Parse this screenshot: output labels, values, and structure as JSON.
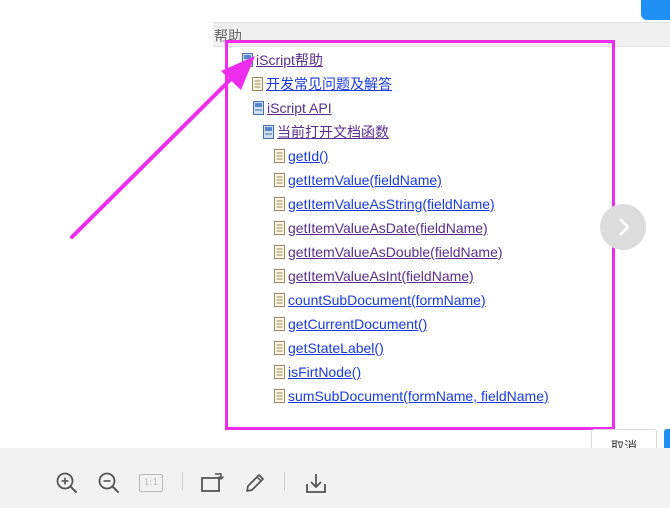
{
  "help_header": {
    "title": "帮助"
  },
  "tree": {
    "root": "iScript帮助",
    "faq": "开发常见问题及解答",
    "api": "iScript API",
    "current_doc_functions": "当前打开文档函数",
    "functions": [
      "getId()",
      "getItemValue(fieldName)",
      "getItemValueAsString(fieldName)",
      "getItemValueAsDate(fieldName)",
      "getItemValueAsDouble(fieldName)",
      "getItemValueAsInt(fieldName)",
      "countSubDocument(formName)",
      "getCurrentDocument()",
      "getStateLabel()",
      "isFirtNode()",
      "sumSubDocument(formName, fieldName)"
    ]
  },
  "dialog": {
    "cancel_label": "取消"
  },
  "toolbar": {
    "ratio_label": "1:1",
    "icons": [
      "zoom-in-icon",
      "zoom-out-icon",
      "actual-size-icon",
      "rotate-icon",
      "edit-icon",
      "download-icon"
    ]
  },
  "annotation": {
    "color": "#ee2cee"
  },
  "colors": {
    "link": "#1a3bd6",
    "visited_link": "#5b2d8c",
    "accent": "#1e8ff3"
  }
}
